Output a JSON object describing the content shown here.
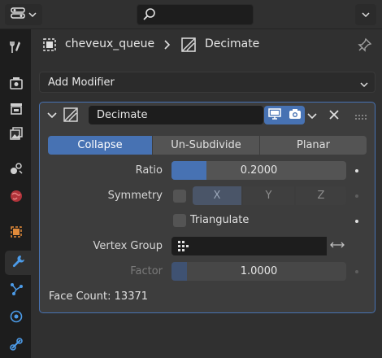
{
  "header": {
    "breadcrumb": {
      "object_name": "cheveux_queue",
      "modifier_name": "Decimate"
    }
  },
  "add_modifier_label": "Add Modifier",
  "modifier": {
    "name": "Decimate",
    "modes": [
      {
        "label": "Collapse",
        "active": true
      },
      {
        "label": "Un-Subdivide",
        "active": false
      },
      {
        "label": "Planar",
        "active": false
      }
    ],
    "ratio": {
      "label": "Ratio",
      "value": "0.2000",
      "fraction": 0.2
    },
    "symmetry": {
      "label": "Symmetry",
      "checked": false,
      "axes": [
        "X",
        "Y",
        "Z"
      ],
      "active_axis": "X"
    },
    "triangulate": {
      "label": "Triangulate",
      "checked": false
    },
    "vertex_group": {
      "label": "Vertex Group",
      "value": ""
    },
    "factor": {
      "label": "Factor",
      "value": "1.0000",
      "fraction": 0.0,
      "enabled": false
    },
    "face_count": "Face Count: 13371"
  },
  "icons": {
    "editor_type": "properties-editor-icon",
    "accent": "#4772b3"
  }
}
